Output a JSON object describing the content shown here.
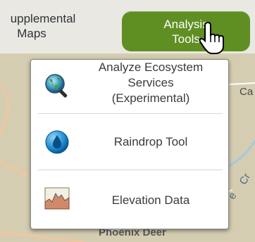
{
  "toolbar": {
    "supplemental_maps": {
      "line1": "upplemental",
      "line2": "Maps"
    },
    "analysis_tools": {
      "line1": "Analysis",
      "line2": "Tools"
    }
  },
  "dropdown": {
    "items": [
      {
        "label_lines": [
          "Analyze Ecosystem",
          "Services",
          "(Experimental)"
        ],
        "icon": "globe-magnifier-icon"
      },
      {
        "label_lines": [
          "Raindrop Tool"
        ],
        "icon": "raindrop-icon"
      },
      {
        "label_lines": [
          "Elevation Data"
        ],
        "icon": "elevation-chart-icon"
      }
    ]
  },
  "map": {
    "labels": {
      "right_partial": "Ca",
      "bottom_partial": "Phoenix Deer",
      "creek_partial": "Cr",
      "creek_partial2": "e"
    }
  },
  "colors": {
    "accent": "#5f8f23",
    "menu_bg": "#ffffff",
    "toolbar_bg": "#e9e8e3"
  }
}
